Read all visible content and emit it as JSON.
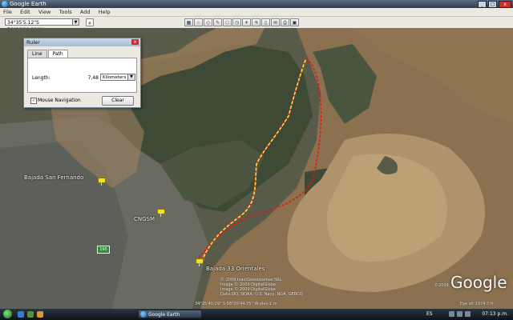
{
  "window": {
    "title": "Google Earth",
    "min": "_",
    "max": "□",
    "close": "x"
  },
  "menu": [
    "File",
    "Edit",
    "View",
    "Tools",
    "Add",
    "Help"
  ],
  "toolbar": {
    "coordinates": "34°35'5.12\"S 58°28'11.21\"W",
    "search_glyph": "⌕",
    "tool_glyphs": [
      "▦",
      "☆",
      "◇",
      "✎",
      "⬡",
      "◷",
      "☀",
      "♃",
      "▯",
      "✉",
      "⎙",
      "▣"
    ]
  },
  "places": {
    "bajada_san_fernando": "Bajada San Fernando",
    "cngsm": "CNGSM",
    "bajada_33": "Bajada 33 Orientales"
  },
  "route_badge": "195",
  "attribution": [
    "© 2009 Inav/Geosistemas SRL",
    "Image © 2009 DigitalGlobe",
    "Image © 2009 DigitalGlobe",
    "Data SIO, NOAA, U.S. Navy, NGA, GEBCO"
  ],
  "status": {
    "pointer": "34°25'40.29\" S  58°30'44.75\" W  elev  1 m",
    "eye_alt": "Eye alt  1974.7 ft"
  },
  "google": {
    "logo": "Google",
    "copyright": "©2009"
  },
  "ruler": {
    "title": "Ruler",
    "tabs": [
      "Line",
      "Path"
    ],
    "length_label": "Length:",
    "length_value": "7,48",
    "unit": "Kilometers",
    "mouse_nav_label": "Mouse Navigation",
    "clear_label": "Clear"
  },
  "taskbar": {
    "task_label": "Google Earth",
    "lang": "ES",
    "clock": "07:13 p.m."
  }
}
